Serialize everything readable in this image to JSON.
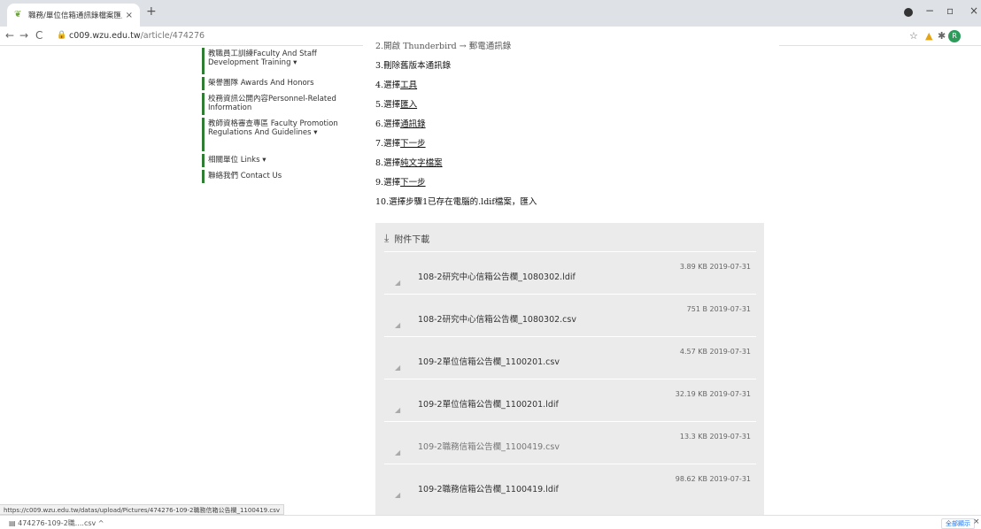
{
  "browser": {
    "tab_title": "職務/單位信箱通訊錄檔案匯入步",
    "tab_close": "×",
    "new_tab": "+",
    "url_host": "c009.wzu.edu.tw",
    "url_path": "/article/474276",
    "back": "←",
    "forward": "→",
    "reload": "C",
    "star": "☆",
    "minimize": "−",
    "maximize": "▫",
    "close": "×",
    "avatar_letter": "R"
  },
  "sidebar": {
    "items": [
      {
        "label": "教職員工訓練Faculty And Staff Development Training ▾"
      },
      {
        "label": "榮譽團隊 Awards And Honors"
      },
      {
        "label": "校務資訊公開內容Personnel-Related Information"
      },
      {
        "label": "教師資格審查專區 Faculty Promotion Regulations And Guidelines ▾"
      },
      {
        "label": "相關單位 Links ▾"
      },
      {
        "label": "聯絡我們 Contact Us"
      }
    ]
  },
  "steps": {
    "s2": "2.開啟 Thunderbird → 郵電通訊錄",
    "s3": "3.刪除舊版本通訊錄",
    "s4a": "4.選擇",
    "s4b": "工具",
    "s5a": "5.選擇",
    "s5b": "匯入",
    "s6a": "6.選擇",
    "s6b": "通訊錄",
    "s7a": "7.選擇",
    "s7b": "下一步",
    "s8a": "8.選擇",
    "s8b": "純文字檔案",
    "s9a": "9.選擇",
    "s9b": "下一步",
    "s10": "10.選擇步驟1已存在電腦的.ldif檔案，匯入"
  },
  "attachments": {
    "heading": "附件下載",
    "files": [
      {
        "name": "108-2研究中心信箱公告欄_1080302.ldif",
        "meta": "3.89 KB 2019-07-31"
      },
      {
        "name": "108-2研究中心信箱公告欄_1080302.csv",
        "meta": "751 B 2019-07-31"
      },
      {
        "name": "109-2單位信箱公告欄_1100201.csv",
        "meta": "4.57 KB 2019-07-31"
      },
      {
        "name": "109-2單位信箱公告欄_1100201.ldif",
        "meta": "32.19 KB 2019-07-31"
      },
      {
        "name": "109-2職務信箱公告欄_1100419.csv",
        "meta": "13.3 KB 2019-07-31"
      },
      {
        "name": "109-2職務信箱公告欄_1100419.ldif",
        "meta": "98.62 KB 2019-07-31"
      }
    ]
  },
  "status_url": "https://c009.wzu.edu.tw/datas/upload/Pictures/474276-109-2職務信箱公告欄_1100419.csv",
  "download_bar": {
    "file": "474276-109-2職....csv ^",
    "show_all": "全部顯示",
    "close": "×"
  }
}
